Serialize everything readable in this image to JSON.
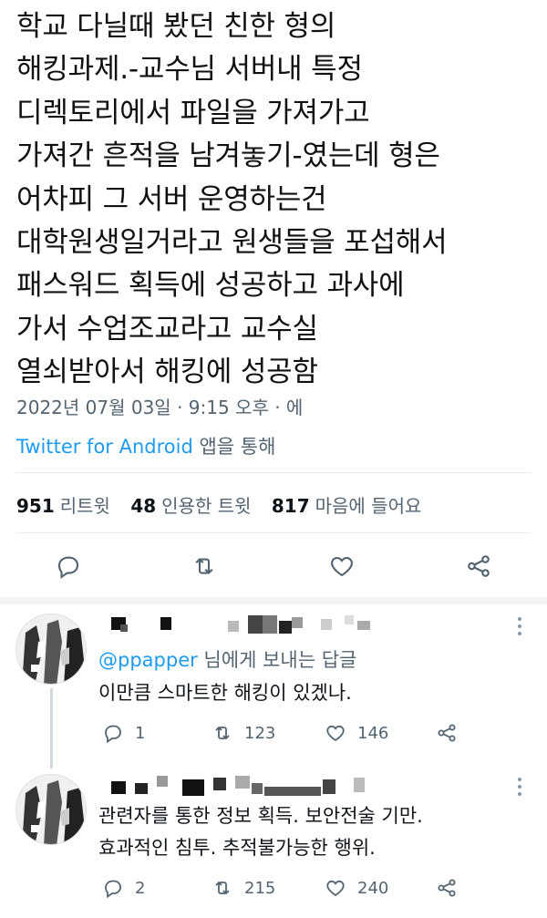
{
  "tweet": {
    "lines": [
      "학교 다닐때 봤던 친한 형의",
      "해킹과제.-교수님 서버내 특정",
      "디렉토리에서 파일을 가져가고",
      "가져간 흔적을 남겨놓기-였는데 형은",
      "어차피 그 서버 운영하는건",
      "대학원생일거라고 원생들을 포섭해서",
      "패스워드 획득에 성공하고 과사에",
      "가서 수업조교라고 교수실",
      "열쇠받아서 해킹에 성공함"
    ],
    "timestamp": "2022년 07월 03일 · 9:15 오후 · 에",
    "source_app": "Twitter for Android",
    "source_suffix": " 앱을 통해",
    "stats": {
      "retweets_count": "951",
      "retweets_label": "리트윗",
      "quotes_count": "48",
      "quotes_label": "인용한 트윗",
      "likes_count": "817",
      "likes_label": "마음에 들어요"
    },
    "action_icons": [
      "reply-icon",
      "retweet-icon",
      "like-icon",
      "share-icon"
    ]
  },
  "replies": [
    {
      "replying_handle": "@ppapper",
      "replying_suffix": " 님에게 보내는 답글",
      "text_lines": [
        "이만큼 스마트한 해킹이 있겠나."
      ],
      "reply_count": "1",
      "retweet_count": "123",
      "like_count": "146"
    },
    {
      "text_lines": [
        "관련자를 통한 정보 획득. 보안전술 기만.",
        "효과적인 침투. 추적불가능한 행위."
      ],
      "reply_count": "2",
      "retweet_count": "215",
      "like_count": "240"
    }
  ],
  "colors": {
    "accent": "#1d9bf0",
    "secondary_text": "#536471",
    "primary_text": "#0f1419",
    "divider": "#e6ecf0"
  }
}
